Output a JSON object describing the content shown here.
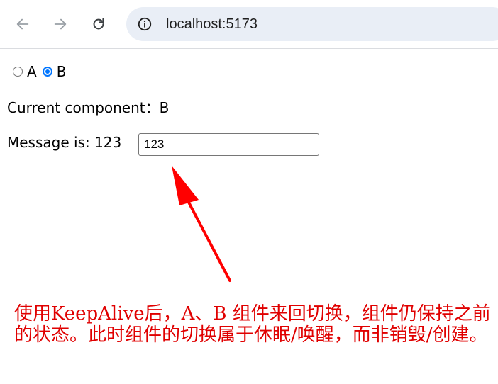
{
  "browser": {
    "back_icon": "arrow-left-icon",
    "forward_icon": "arrow-right-icon",
    "reload_icon": "reload-icon",
    "site_info_icon": "info-circle-icon",
    "url": "localhost:5173"
  },
  "radios": {
    "option_a": "A",
    "option_b": "B",
    "selected": "B",
    "accent_color": "#0075ff"
  },
  "content": {
    "current_component": "Current component：B",
    "message_label": "Message is: 123",
    "input_value": "123"
  },
  "annotation": {
    "text": "使用KeepAlive后，A、B 组件来回切换，组件仍保持之前的状态。此时组件的切换属于休眠/唤醒，而非销毁/创建。",
    "color": "#e00000"
  }
}
